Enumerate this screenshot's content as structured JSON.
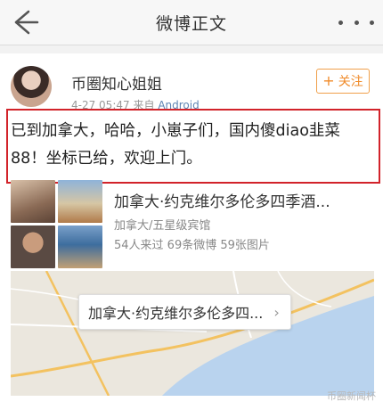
{
  "nav": {
    "title": "微博正文"
  },
  "post": {
    "username": "币圈知心姐姐",
    "time": "4-27 05:47",
    "source_prefix": "来自",
    "source": "Android",
    "follow_label": "关注",
    "text": "已到加拿大，哈哈，小崽子们，国内傻diao韭菜88！坐标已给，欢迎上门。"
  },
  "location": {
    "title": "加拿大·约克维尔多伦多四季酒...",
    "category": "加拿大/五星级宾馆",
    "stats": "54人来过 69条微博 59张图片"
  },
  "map": {
    "label": "加拿大·约克维尔多伦多四..."
  },
  "watermark": "币圈新闻杯",
  "colors": {
    "accent": "#f08b2a",
    "highlight": "#d2232a",
    "link": "#5d84b3"
  }
}
